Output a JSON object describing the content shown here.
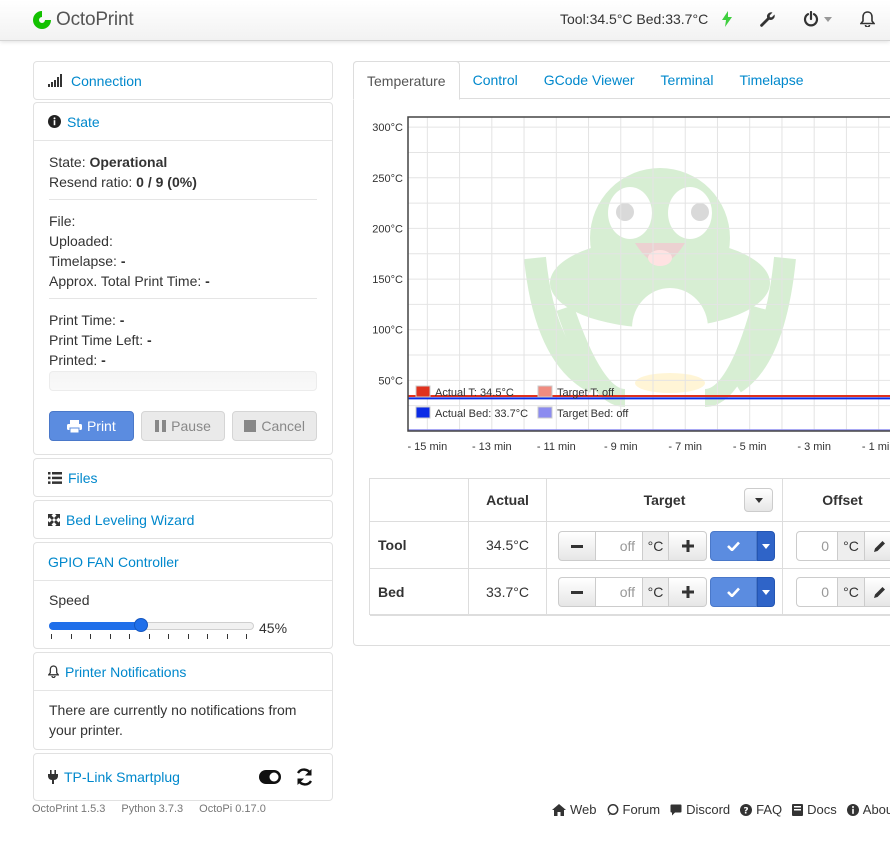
{
  "brand": {
    "name": "OctoPrint"
  },
  "navbar": {
    "temps": "Tool:34.5°C Bed:33.7°C"
  },
  "sidebar": {
    "connection": {
      "label": "Connection"
    },
    "state": {
      "label": "State",
      "state_label": "State:",
      "state_value": "Operational",
      "resend_label": "Resend ratio:",
      "resend_value": "0 / 9 (0%)",
      "file_label": "File:",
      "uploaded_label": "Uploaded:",
      "timelapse_label": "Timelapse:",
      "timelapse_value": "-",
      "approx_label": "Approx. Total Print Time:",
      "approx_value": "-",
      "print_time_label": "Print Time:",
      "print_time_value": "-",
      "print_left_label": "Print Time Left:",
      "print_left_value": "-",
      "printed_label": "Printed:",
      "printed_value": "-",
      "buttons": {
        "print": "Print",
        "pause": "Pause",
        "cancel": "Cancel"
      }
    },
    "files": {
      "label": "Files"
    },
    "bed_leveling": {
      "label": "Bed Leveling Wizard"
    },
    "gpio": {
      "label": "GPIO FAN Controller",
      "speed_label": "Speed",
      "speed_value": 45,
      "speed_text": "45%"
    },
    "notifications": {
      "label": "Printer Notifications",
      "message": "There are currently no notifications from your printer."
    },
    "smartplug": {
      "label": "TP-Link Smartplug"
    }
  },
  "tabs": [
    {
      "label": "Temperature",
      "active": true
    },
    {
      "label": "Control",
      "active": false
    },
    {
      "label": "GCode Viewer",
      "active": false
    },
    {
      "label": "Terminal",
      "active": false
    },
    {
      "label": "Timelapse",
      "active": false
    }
  ],
  "chart_data": {
    "type": "line",
    "title": "",
    "xlabel": "",
    "ylabel": "",
    "ylim": [
      0,
      310
    ],
    "y_ticks": [
      "300°C",
      "250°C",
      "200°C",
      "150°C",
      "100°C",
      "50°C"
    ],
    "x_ticks": [
      "- 15 min",
      "- 13 min",
      "- 11 min",
      "- 9 min",
      "- 7 min",
      "- 5 min",
      "- 3 min",
      "- 1 min"
    ],
    "x": [
      -15.5,
      -1
    ],
    "series": [
      {
        "name": "Actual T: 34.5°C",
        "color": "#e0321e",
        "values": [
          34.5,
          34.5
        ]
      },
      {
        "name": "Target T: off",
        "color": "#f08c80",
        "values": []
      },
      {
        "name": "Actual Bed: 33.7°C",
        "color": "#0a2be6",
        "values": [
          33.7,
          33.7
        ]
      },
      {
        "name": "Target Bed: off",
        "color": "#8c8cf0",
        "values": []
      }
    ],
    "grid": true,
    "legend": "bottom-left"
  },
  "temp_table": {
    "headers": {
      "actual": "Actual",
      "target": "Target",
      "offset": "Offset"
    },
    "rows": [
      {
        "label": "Tool",
        "actual": "34.5°C",
        "target": "off",
        "unit": "°C",
        "offset": "0"
      },
      {
        "label": "Bed",
        "actual": "33.7°C",
        "target": "off",
        "unit": "°C",
        "offset": "0"
      }
    ]
  },
  "footer": {
    "versions": [
      "OctoPrint 1.5.3",
      "Python 3.7.3",
      "OctoPi 0.17.0"
    ],
    "links": [
      "Web",
      "Forum",
      "Discord",
      "FAQ",
      "Docs",
      "About"
    ]
  },
  "colors": {
    "link": "#0088cc",
    "primary": "#5b8ce0",
    "slider": "#1f6fea"
  }
}
